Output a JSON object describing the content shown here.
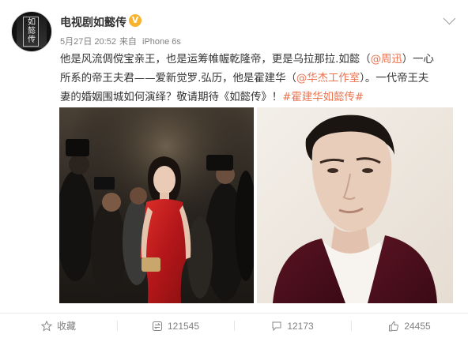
{
  "post": {
    "author": "电视剧如懿传",
    "avatar_text": "如懿传",
    "date": "5月27日 20:52",
    "source_prefix": "来自",
    "source": "iPhone 6s",
    "text": {
      "line1_a": "他是风流倜傥宝亲王，也是运筹帷幄乾隆帝，更是乌拉那拉.如懿（",
      "mention1": "@周迅",
      "line1_b": "）一心",
      "line2_a": "所系的帝王夫君——爱新觉罗.弘历，他是霍建华（",
      "mention2": "@华杰工作室",
      "line2_b": "）。一代帝王夫",
      "line3_a": "妻的婚姻围城如何演绎？敬请期待《如懿传》！",
      "hashtag": "#霍建华如懿传#"
    }
  },
  "actions": {
    "favorite_label": "收藏",
    "repost_count": "121545",
    "comment_count": "12173",
    "like_count": "24455"
  },
  "colors": {
    "link": "#eb7350",
    "verified": "#f7b32b",
    "muted": "#808080"
  },
  "icons": [
    "star-icon",
    "repost-icon",
    "comment-icon",
    "thumbs-up-icon",
    "chevron-down-icon",
    "verified-icon"
  ]
}
